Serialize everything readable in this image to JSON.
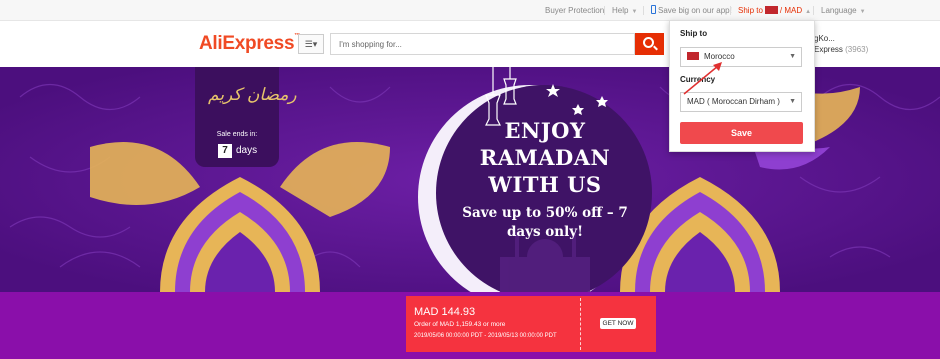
{
  "topbar": {
    "buyer_protection": "Buyer Protection",
    "help": "Help",
    "app_promo": "Save big on our app!",
    "ship_to": "Ship to",
    "currency": "/ MAD",
    "language": "Language"
  },
  "header": {
    "logo": "AliExpress",
    "search_placeholder": "I'm shopping for...",
    "account_line1": "gKo...",
    "account_line2": "Express",
    "account_count": "(3963)"
  },
  "banner": {
    "calligraphy": "رمضان كريم",
    "sale_ends": "Sale ends in:",
    "days_number": "7",
    "days_label": "days",
    "headline": "ENJOY RAMADAN WITH US",
    "subline": "Save up to 50% off – 7 days only!"
  },
  "coupon": {
    "amount": "MAD 144.93",
    "order": "Order of MAD 1,159.43 or more",
    "dates": "2019/05/06 00:00:00 PDT - 2019/05/13 00:00:00 PDT",
    "cta": "GET NOW"
  },
  "panel": {
    "ship_label": "Ship to",
    "country": "Morocco",
    "currency_label": "Currency",
    "currency_value": "MAD ( Moroccan Dirham )",
    "save": "Save"
  },
  "colors": {
    "accent": "#e62e04",
    "banner_purple": "#5b1592",
    "gold": "#e7b557",
    "coupon_red": "#f5333f",
    "save_red": "#f0494d"
  },
  "icons": [
    "phone-icon",
    "morocco-flag-icon",
    "chevron-down-icon",
    "search-icon",
    "category-menu-icon",
    "crescent-moon-icon",
    "lantern-icon",
    "star-icon",
    "arrow-annotation"
  ]
}
